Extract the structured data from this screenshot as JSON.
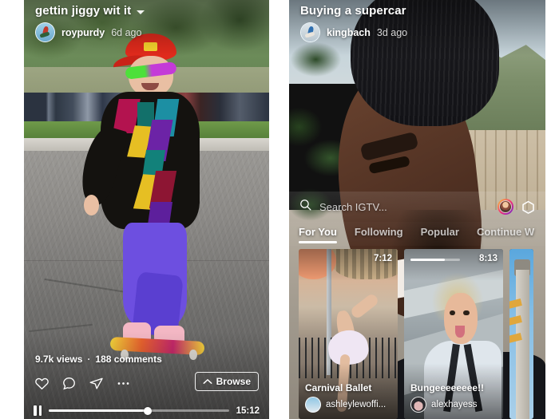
{
  "left_phone": {
    "video_title": "gettin jiggy wit it",
    "title_caret_icon": "chevron-down-icon",
    "author": "roypurdy",
    "age": "6d ago",
    "views": "9.7k views",
    "separator": "·",
    "comments": "188 comments",
    "actions": [
      {
        "name": "like-icon",
        "glyph": "heart"
      },
      {
        "name": "comment-icon",
        "glyph": "bubble"
      },
      {
        "name": "share-icon",
        "glyph": "plane"
      },
      {
        "name": "more-options-icon",
        "glyph": "dots"
      }
    ],
    "browse_label": "Browse",
    "browse_icon": "chevron-up-icon",
    "player": {
      "pause_icon": "pause-icon",
      "progress_percent": 55,
      "duration": "15:12"
    }
  },
  "right_phone": {
    "video_title": "Buying a supercar",
    "author": "kingbach",
    "age": "3d ago",
    "search": {
      "placeholder": "Search IGTV...",
      "search_icon": "search-icon",
      "avatar_icon": "profile-avatar",
      "gear_icon": "igtv-settings-icon"
    },
    "tabs": [
      {
        "label": "For You",
        "active": true
      },
      {
        "label": "Following",
        "active": false
      },
      {
        "label": "Popular",
        "active": false
      },
      {
        "label": "Continue W",
        "active": false
      }
    ],
    "cards": [
      {
        "title": "Carnival Ballet",
        "user": "ashleylewoffi...",
        "time": "7:12",
        "progress_percent": 0
      },
      {
        "title": "Bungeeeeeeee!!",
        "user": "alexhayess",
        "time": "8:13",
        "progress_percent": 70
      },
      {
        "title": "",
        "user": "",
        "time": "",
        "progress_percent": 0
      }
    ]
  },
  "colors": {
    "page_background": "#ffffff",
    "overlay_text": "#ffffff",
    "accent_white": "#ffffff",
    "muted_text": "rgba(255,255,255,0.78)"
  }
}
